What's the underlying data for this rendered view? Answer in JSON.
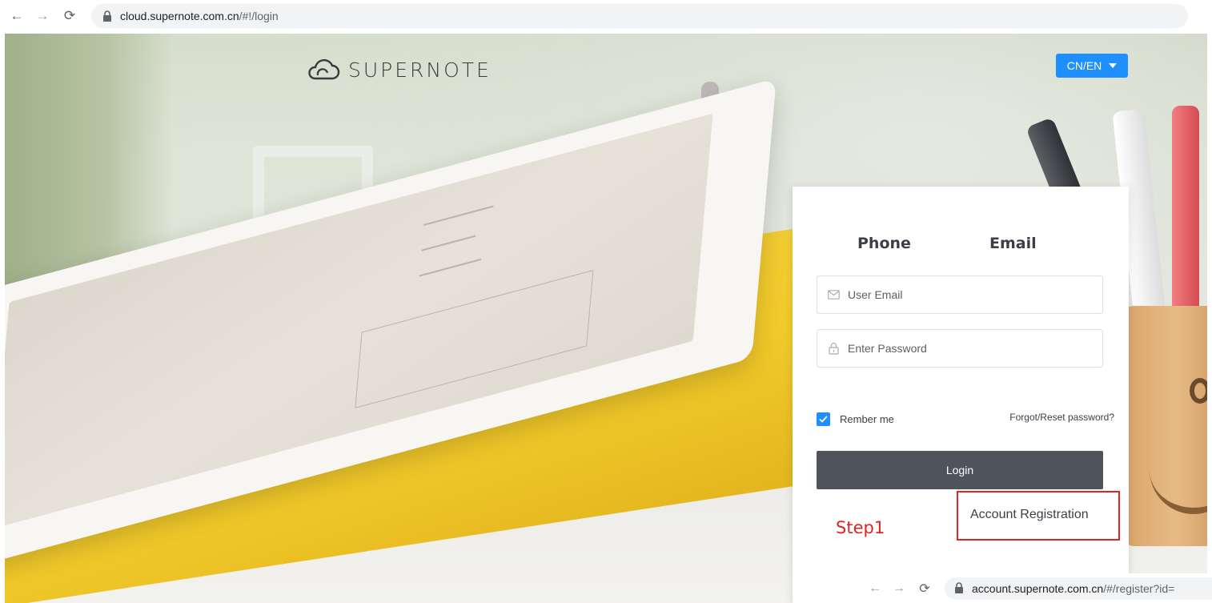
{
  "browser": {
    "url_domain": "cloud.supernote.com.cn",
    "url_path": "/#!/login"
  },
  "header": {
    "logo_text": "SUPERNOTE",
    "language_label": "CN/EN"
  },
  "login": {
    "tab_phone": "Phone",
    "tab_email": "Email",
    "email_placeholder": "User Email",
    "password_placeholder": "Enter Password",
    "remember_label": "Rember me",
    "remember_checked": true,
    "forgot_link": "Forgot/Reset password?",
    "login_button": "Login",
    "register_link": "Account Registration"
  },
  "annotation": {
    "step_label": "Step1",
    "highlight_color": "#e32222"
  },
  "overlay_browser": {
    "url_domain": "account.supernote.com.cn",
    "url_path": "/#/register?id="
  },
  "colors": {
    "accent": "#1e8fff",
    "button_dark": "#4f535b",
    "folder_yellow": "#f1c92a"
  }
}
